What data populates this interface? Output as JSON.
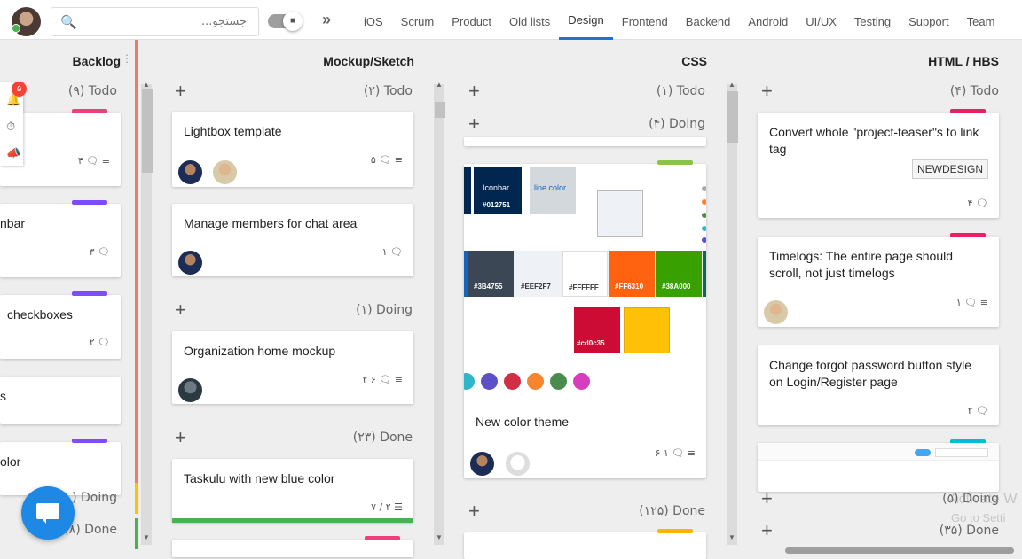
{
  "header": {
    "search_placeholder": "جستجو...",
    "tabs": [
      "iOS",
      "Scrum",
      "Product",
      "Old lists",
      "Design",
      "Frontend",
      "Backend",
      "Android",
      "UI/UX",
      "Testing",
      "Support",
      "Team"
    ],
    "active_tab": "Design"
  },
  "notifications": {
    "count": "۵"
  },
  "columns": {
    "backlog": {
      "title": "Backlog",
      "todo": "(۹) Todo",
      "doing": "(۰) Doing",
      "done": "(۸) Done",
      "cards": [
        {
          "title": "",
          "meta": "۴"
        },
        {
          "title": "nbar",
          "meta": "۳"
        },
        {
          "title": "checkboxes",
          "meta": "۲"
        },
        {
          "title": "s",
          "meta": ""
        },
        {
          "title": "olor",
          "meta": ""
        }
      ]
    },
    "mockup": {
      "title": "Mockup/Sketch",
      "todo": "(۲) Todo",
      "doing": "(۱) Doing",
      "done": "(۲۳) Done",
      "cards": [
        {
          "title": "Lightbox template",
          "meta": "۵"
        },
        {
          "title": "Manage members for chat area",
          "meta": "۱"
        },
        {
          "title": "Organization home mockup",
          "meta": "۲ ۶"
        },
        {
          "title": "Taskulu with new blue color",
          "meta": "۷ / ۲"
        }
      ]
    },
    "css": {
      "title": "CSS",
      "todo": "(۱) Todo",
      "doing": "(۴) Doing",
      "done": "(۱۲۵) Done",
      "card": {
        "title": "New color theme",
        "meta": "۶ ۱",
        "swatches": [
          {
            "label": "Iconbar",
            "hex": "#012751"
          },
          {
            "label": "line color",
            "hex": "#D3D8DC"
          },
          {
            "label": "#3B4755",
            "hex": "#3B4755"
          },
          {
            "label": "#EEF2F7",
            "hex": "#EEF2F7"
          },
          {
            "label": "#FFFFFF",
            "hex": "#FFFFFF"
          },
          {
            "label": "#FF6310",
            "hex": "#FF6310"
          },
          {
            "label": "#38A000",
            "hex": "#38A000"
          },
          {
            "label": "#cd0c35",
            "hex": "#cd0c35"
          }
        ],
        "dots": [
          "#2FB7C9",
          "#5C4FC7",
          "#D12E46",
          "#F5852E",
          "#4A8C4F",
          "#D63EBF"
        ]
      }
    },
    "html": {
      "title": "HTML / HBS",
      "todo": "(۴) Todo",
      "doing": "(۵) Doing",
      "done": "(۳۵) Done",
      "cards": [
        {
          "title": "Convert whole \"project-teaser\"s to link tag",
          "tag": "NEWDESIGN",
          "meta": "۴"
        },
        {
          "title": "Timelogs: The entire page should scroll, not just timelogs",
          "meta": "۱"
        },
        {
          "title": "Change forgot password button style on Login/Register page",
          "meta": "۲"
        }
      ]
    }
  },
  "watermark": {
    "line1": "Activate W",
    "line2": "Go to Setti"
  },
  "colors": {
    "accent": "#1976d2",
    "chat": "#1e88e5",
    "red": "#f44336"
  }
}
